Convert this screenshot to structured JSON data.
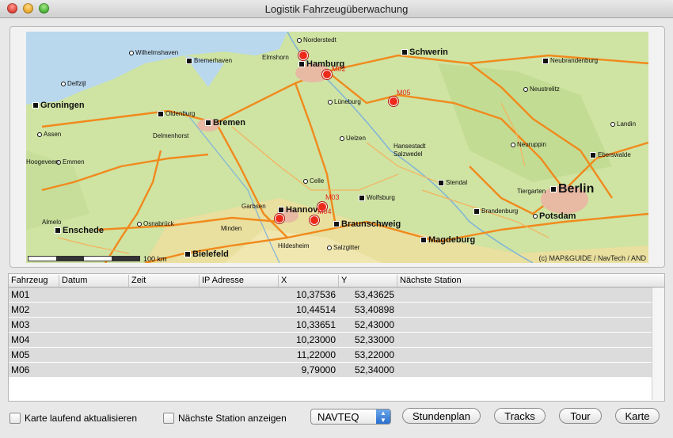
{
  "window": {
    "title": "Logistik Fahrzeugüberwachung"
  },
  "map": {
    "copyright": "(c) MAP&GUIDE / NavTech / AND",
    "scale_label": "100 km",
    "cities": [
      {
        "name": "Norderstedt"
      },
      {
        "name": "Wilhelmshaven"
      },
      {
        "name": "Bremerhaven"
      },
      {
        "name": "Elmshorn"
      },
      {
        "name": "Hamburg"
      },
      {
        "name": "Schwerin"
      },
      {
        "name": "Neubrandenburg"
      },
      {
        "name": "Delfzijl"
      },
      {
        "name": "Groningen"
      },
      {
        "name": "Oldenburg"
      },
      {
        "name": "Bremen"
      },
      {
        "name": "Lüneburg"
      },
      {
        "name": "Neustrelitz"
      },
      {
        "name": "Assen"
      },
      {
        "name": "Delmenhorst"
      },
      {
        "name": "Uelzen"
      },
      {
        "name": "Landin"
      },
      {
        "name": "Neuruppin"
      },
      {
        "name": "Hansestadt Salzwedel"
      },
      {
        "name": "Eberswalde"
      },
      {
        "name": "Emmen"
      },
      {
        "name": "Hoogeveen"
      },
      {
        "name": "Celle"
      },
      {
        "name": "Stendal"
      },
      {
        "name": "Tiergarten"
      },
      {
        "name": "Berlin"
      },
      {
        "name": "Garbsen"
      },
      {
        "name": "Wolfsburg"
      },
      {
        "name": "Hannover"
      },
      {
        "name": "Brandenburg"
      },
      {
        "name": "Potsdam"
      },
      {
        "name": "Enschede"
      },
      {
        "name": "Osnabrück"
      },
      {
        "name": "Minden"
      },
      {
        "name": "Braunschweig"
      },
      {
        "name": "Hildesheim"
      },
      {
        "name": "Salzgitter"
      },
      {
        "name": "Magdeburg"
      },
      {
        "name": "Bielefeld"
      },
      {
        "name": "Almelo"
      }
    ],
    "vehicles": [
      {
        "label": "M01"
      },
      {
        "label": "M02"
      },
      {
        "label": "M03"
      },
      {
        "label": "M04"
      },
      {
        "label": "M05"
      },
      {
        "label": "M06"
      }
    ]
  },
  "table": {
    "columns": [
      "Fahrzeug",
      "Datum",
      "Zeit",
      "IP Adresse",
      "X",
      "Y",
      "Nächste Station"
    ],
    "rows": [
      {
        "fahrzeug": "M01",
        "datum": "",
        "zeit": "",
        "ip": "",
        "x": "10,37536",
        "y": "53,43625",
        "station": ""
      },
      {
        "fahrzeug": "M02",
        "datum": "",
        "zeit": "",
        "ip": "",
        "x": "10,44514",
        "y": "53,40898",
        "station": ""
      },
      {
        "fahrzeug": "M03",
        "datum": "",
        "zeit": "",
        "ip": "",
        "x": "10,33651",
        "y": "52,43000",
        "station": ""
      },
      {
        "fahrzeug": "M04",
        "datum": "",
        "zeit": "",
        "ip": "",
        "x": "10,23000",
        "y": "52,33000",
        "station": ""
      },
      {
        "fahrzeug": "M05",
        "datum": "",
        "zeit": "",
        "ip": "",
        "x": "11,22000",
        "y": "53,22000",
        "station": ""
      },
      {
        "fahrzeug": "M06",
        "datum": "",
        "zeit": "",
        "ip": "",
        "x": "9,79000",
        "y": "52,34000",
        "station": ""
      }
    ]
  },
  "controls": {
    "auto_refresh_label": "Karte laufend aktualisieren",
    "show_station_label": "Nächste Station anzeigen",
    "provider_value": "NAVTEQ",
    "schedule_button": "Stundenplan",
    "tracks_button": "Tracks",
    "tour_button": "Tour",
    "map_button": "Karte"
  },
  "colors": {
    "accent": "#2a6fcf",
    "vehicle": "#ee2b1b",
    "road": "#f08a1c"
  }
}
